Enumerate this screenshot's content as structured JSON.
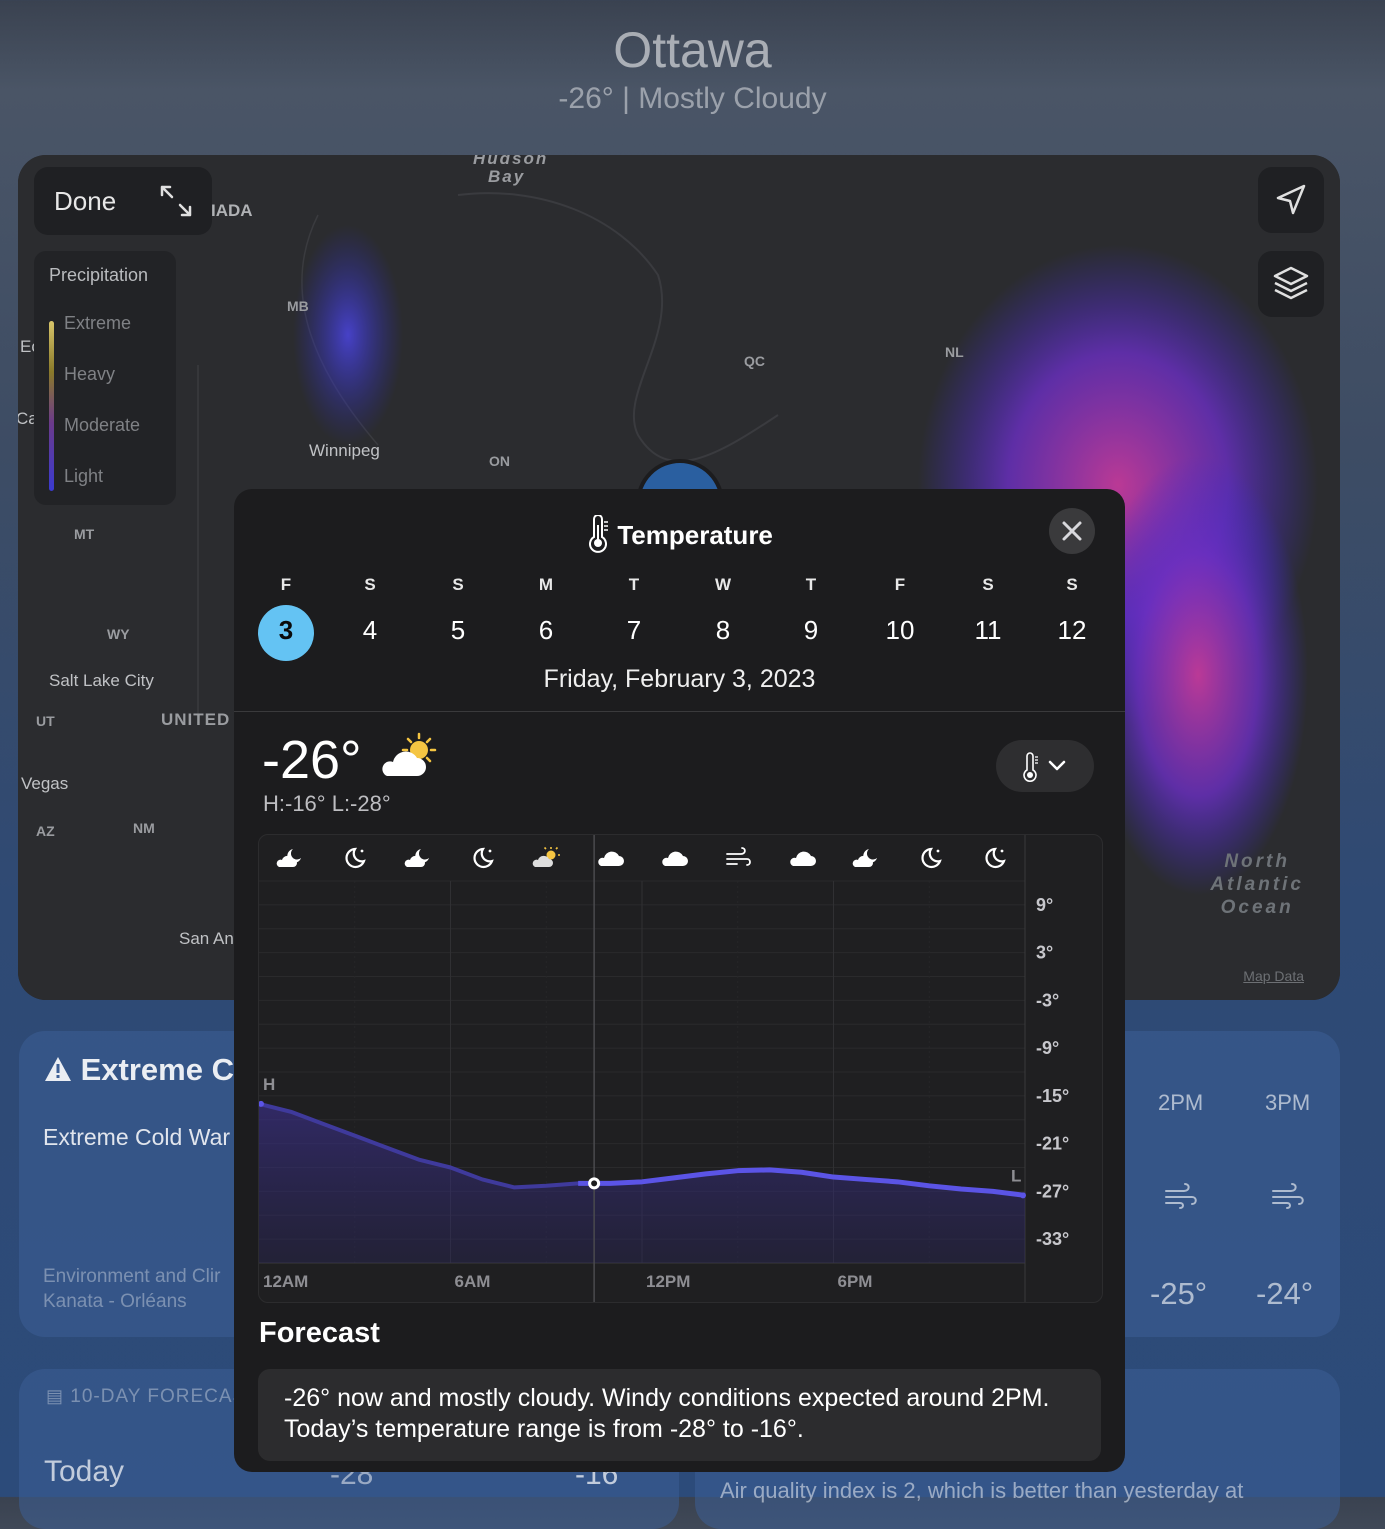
{
  "header": {
    "city": "Ottawa",
    "conditions": "-26° | Mostly Cloudy"
  },
  "map": {
    "done_label": "Done",
    "legend": {
      "title": "Precipitation",
      "items": [
        "Extreme",
        "Heavy",
        "Moderate",
        "Light"
      ]
    },
    "labels": {
      "hudson": "Hudson",
      "bay": "Bay",
      "canada": "IADA",
      "mb": "MB",
      "qc": "QC",
      "nl": "NL",
      "winnipeg": "Winnipeg",
      "on": "ON",
      "mt": "MT",
      "wy": "WY",
      "salt_lake": "Salt Lake City",
      "ut": "UT",
      "united": "UNITED S",
      "vegas": "Vegas",
      "az": "AZ",
      "nm": "NM",
      "san_an": "San An",
      "ec": "Ec",
      "cal": "Cal"
    },
    "ocean": [
      "North",
      "Atlantic",
      "Ocean"
    ],
    "map_data_link": "Map Data"
  },
  "background": {
    "alert_title": "Extreme Co",
    "alert_body": "Extreme Cold War",
    "alert_source_line1": "Environment and Clir",
    "alert_source_line2": "Kanata - Orléans",
    "hours": [
      {
        "label": "2PM",
        "temp": "-25°"
      },
      {
        "label": "3PM",
        "temp": "-24°"
      }
    ],
    "ten_day_header": "10-DAY FORECAS",
    "today_label": "Today",
    "today_low": "-28°",
    "today_high": "-16°",
    "aqi_text": "Air quality index is 2, which is better than yesterday at"
  },
  "modal": {
    "title": "Temperature",
    "days": [
      {
        "dow": "F",
        "num": "3",
        "selected": true
      },
      {
        "dow": "S",
        "num": "4"
      },
      {
        "dow": "S",
        "num": "5"
      },
      {
        "dow": "M",
        "num": "6"
      },
      {
        "dow": "T",
        "num": "7"
      },
      {
        "dow": "W",
        "num": "8"
      },
      {
        "dow": "T",
        "num": "9"
      },
      {
        "dow": "F",
        "num": "10"
      },
      {
        "dow": "S",
        "num": "11"
      },
      {
        "dow": "S",
        "num": "12"
      }
    ],
    "date_full": "Friday, February 3, 2023",
    "current_temp": "-26°",
    "high_low": "H:-16° L:-28°",
    "forecast_title": "Forecast",
    "forecast_text": "-26° now and mostly cloudy. Windy conditions expected around 2PM. Today’s temperature range is from -28° to -16°.",
    "colors": {
      "selected_day": "#64c3f3",
      "line": "#5b54e6"
    }
  },
  "chart_data": {
    "type": "area",
    "title": "",
    "xlabel": "",
    "ylabel": "",
    "x_tick_labels": [
      "12AM",
      "6AM",
      "12PM",
      "6PM"
    ],
    "y_tick_labels": [
      "9°",
      "3°",
      "-3°",
      "-9°",
      "-15°",
      "-21°",
      "-27°",
      "-33°"
    ],
    "ylim": [
      -36,
      12
    ],
    "x": [
      0,
      1,
      2,
      3,
      4,
      5,
      6,
      7,
      8,
      9,
      10,
      11,
      12,
      13,
      14,
      15,
      16,
      17,
      18,
      19,
      20,
      21,
      22,
      23,
      24
    ],
    "values": [
      -16,
      -17,
      -18.5,
      -20,
      -21.5,
      -23,
      -24,
      -25.5,
      -26.5,
      -26.3,
      -26,
      -26,
      -25.8,
      -25.3,
      -24.8,
      -24.4,
      -24.3,
      -24.6,
      -25.2,
      -25.5,
      -25.8,
      -26.3,
      -26.7,
      -27,
      -27.5
    ],
    "current_hour": 10.5,
    "high_marker": "H",
    "low_marker": "L",
    "hourly_icons": [
      "cloud-moon-icon",
      "moon-icon",
      "cloud-moon-icon",
      "moon-icon",
      "cloud-sun-icon",
      "cloud-icon",
      "cloud-icon",
      "wind-icon",
      "cloud-icon",
      "cloud-moon-icon",
      "moon-icon",
      "moon-icon"
    ],
    "grid": true
  }
}
